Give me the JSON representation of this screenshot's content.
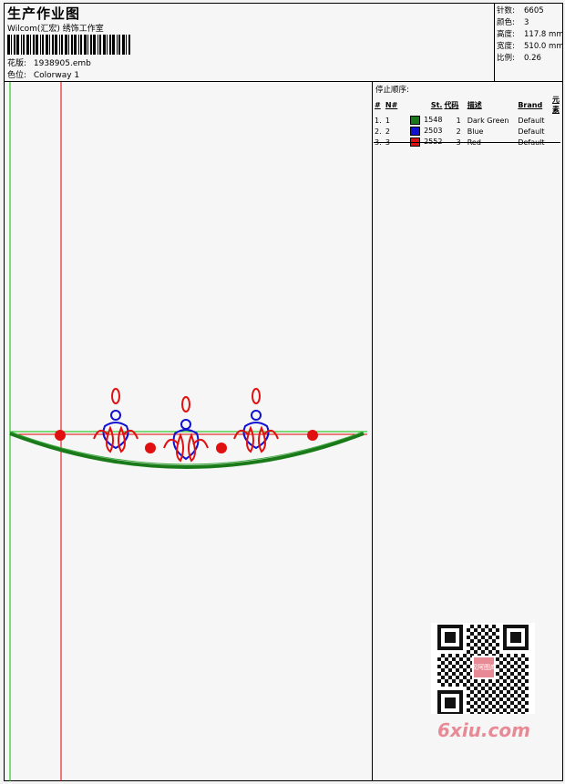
{
  "header": {
    "title": "生产作业图",
    "company": "Wilcom(汇宏) 绣饰工作室",
    "design_label": "花版:",
    "design_value": "1938905.emb",
    "colorway_label": "色位:",
    "colorway_value": "Colorway 1"
  },
  "stats": {
    "stitches_label": "针数:",
    "stitches_value": "6605",
    "colors_label": "颜色:",
    "colors_value": "3",
    "height_label": "高度:",
    "height_value": "117.8 mm",
    "width_label": "宽度:",
    "width_value": "510.0 mm",
    "scale_label": "比例:",
    "scale_value": "0.26"
  },
  "sequence": {
    "title": "停止顺序:",
    "columns": [
      "#",
      "N#",
      "St.",
      "代码",
      "描述",
      "Brand",
      "元素"
    ],
    "rows": [
      {
        "num": "1.",
        "n": "1",
        "st": "1548",
        "code": "1",
        "desc": "Dark Green",
        "brand": "Default",
        "color": "#1a7a1a"
      },
      {
        "num": "2.",
        "n": "2",
        "st": "2503",
        "code": "2",
        "desc": "Blue",
        "brand": "Default",
        "color": "#1010d0"
      },
      {
        "num": "3.",
        "n": "3",
        "st": "2552",
        "code": "3",
        "desc": "Red",
        "brand": "Default",
        "color": "#e01010"
      }
    ]
  },
  "watermark": "6xiu.com",
  "qr_center_text": "汉阿图库"
}
